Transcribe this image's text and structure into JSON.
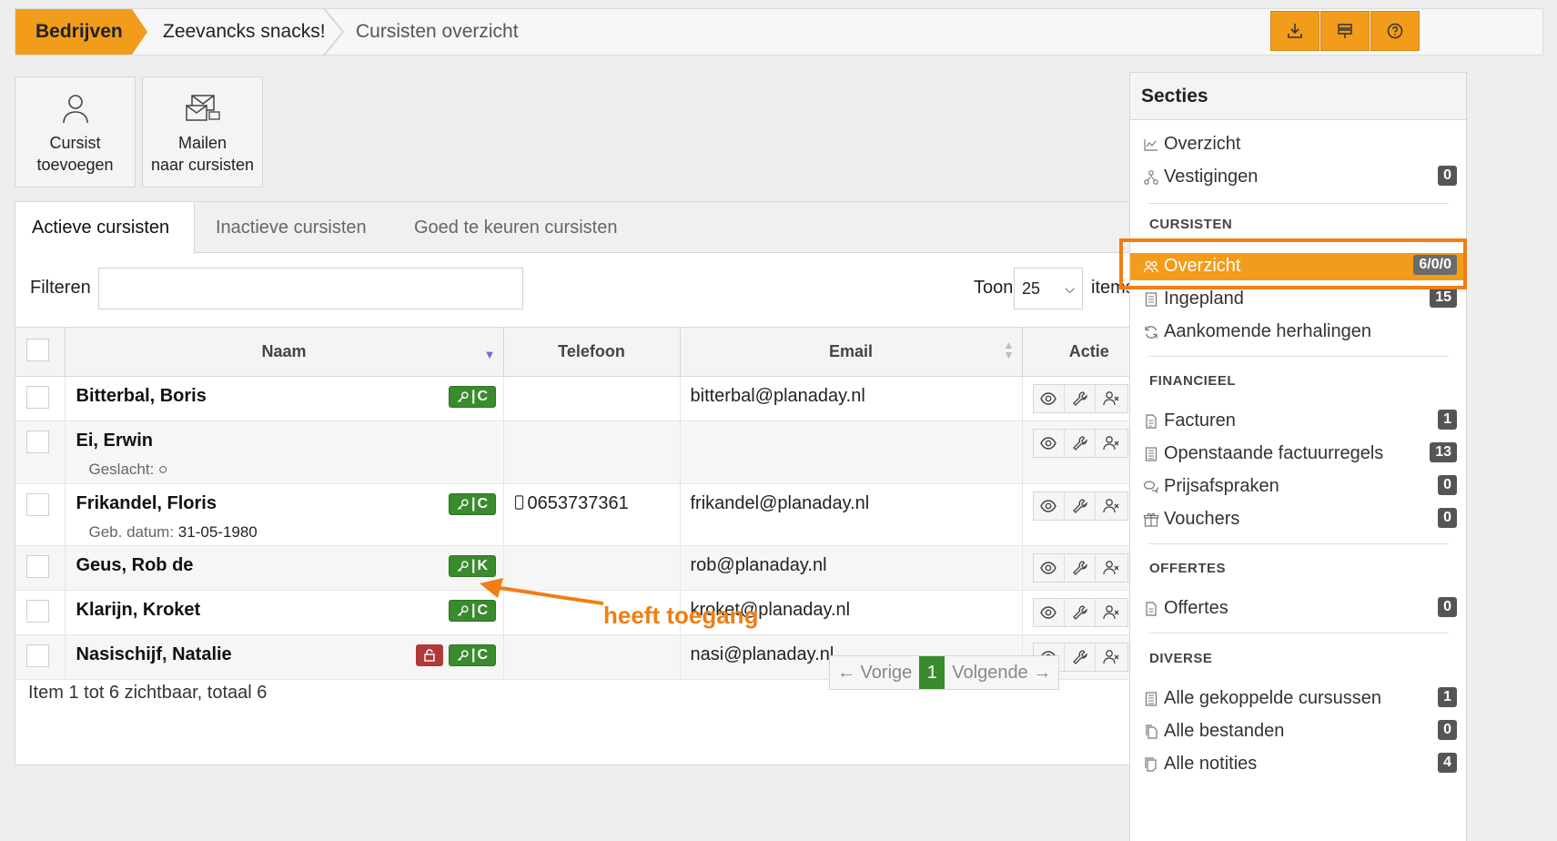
{
  "breadcrumb": {
    "items": [
      "Bedrijven",
      "Zeevancks snacks!",
      "Cursisten overzicht"
    ]
  },
  "top_buttons": [
    {
      "icon": "download-icon"
    },
    {
      "icon": "columns-icon"
    },
    {
      "icon": "help-icon"
    }
  ],
  "tiles": [
    {
      "line1": "Cursist",
      "line2": "toevoegen",
      "icon": "user-icon"
    },
    {
      "line1": "Mailen",
      "line2": "naar cursisten",
      "icon": "mail-icon"
    }
  ],
  "tabs": [
    "Actieve cursisten",
    "Inactieve cursisten",
    "Goed te keuren cursisten"
  ],
  "filter": {
    "label": "Filteren",
    "value": ""
  },
  "pagesize": {
    "label_before": "Toon",
    "value": "25",
    "label_after": "items"
  },
  "columns": [
    "Naam",
    "Telefoon",
    "Email",
    "Actie"
  ],
  "rows": [
    {
      "name": "Bitterbal, Boris",
      "sub_label": "",
      "sub_value": "",
      "phone": "",
      "email": "bitterbal@planaday.nl",
      "badge": "C",
      "locked": false
    },
    {
      "name": "Ei, Erwin",
      "sub_label": "Geslacht:",
      "sub_value": "○",
      "phone": "",
      "email": "",
      "badge": "",
      "locked": false
    },
    {
      "name": "Frikandel, Floris",
      "sub_label": "Geb. datum:",
      "sub_value": "31-05-1980",
      "phone": "0653737361",
      "email": "frikandel@planaday.nl",
      "badge": "C",
      "locked": false
    },
    {
      "name": "Geus, Rob de",
      "sub_label": "",
      "sub_value": "",
      "phone": "",
      "email": "rob@planaday.nl",
      "badge": "K",
      "locked": false
    },
    {
      "name": "Klarijn, Kroket",
      "sub_label": "",
      "sub_value": "",
      "phone": "",
      "email": "kroket@planaday.nl",
      "badge": "C",
      "locked": false
    },
    {
      "name": "Nasischijf, Natalie",
      "sub_label": "",
      "sub_value": "",
      "phone": "",
      "email": "nasi@planaday.nl",
      "badge": "C",
      "locked": true
    }
  ],
  "footer": {
    "summary": "Item 1 tot 6 zichtbaar, totaal 6",
    "prev": "← Vorige",
    "page": "1",
    "next": "Volgende →"
  },
  "annotation": "heeft toegang",
  "sidebar": {
    "title": "Secties",
    "top_items": [
      {
        "label": "Overzicht",
        "count": ""
      },
      {
        "label": "Vestigingen",
        "count": "0"
      }
    ],
    "sections": [
      {
        "title": "CURSISTEN",
        "items": [
          {
            "label": "Overzicht",
            "count": "6/0/0"
          },
          {
            "label": "Ingepland",
            "count": "15"
          },
          {
            "label": "Aankomende herhalingen",
            "count": ""
          }
        ]
      },
      {
        "title": "FINANCIEEL",
        "items": [
          {
            "label": "Facturen",
            "count": "1"
          },
          {
            "label": "Openstaande factuurregels",
            "count": "13"
          },
          {
            "label": "Prijsafspraken",
            "count": "0"
          },
          {
            "label": "Vouchers",
            "count": "0"
          }
        ]
      },
      {
        "title": "OFFERTES",
        "items": [
          {
            "label": "Offertes",
            "count": "0"
          }
        ]
      },
      {
        "title": "DIVERSE",
        "items": [
          {
            "label": "Alle gekoppelde cursussen",
            "count": "1"
          },
          {
            "label": "Alle bestanden",
            "count": "0"
          },
          {
            "label": "Alle notities",
            "count": "4"
          }
        ]
      }
    ]
  },
  "colors": {
    "accent": "#f29c1b",
    "highlight": "#f07e14",
    "success": "#3a8a2e",
    "danger": "#b03a3a"
  }
}
